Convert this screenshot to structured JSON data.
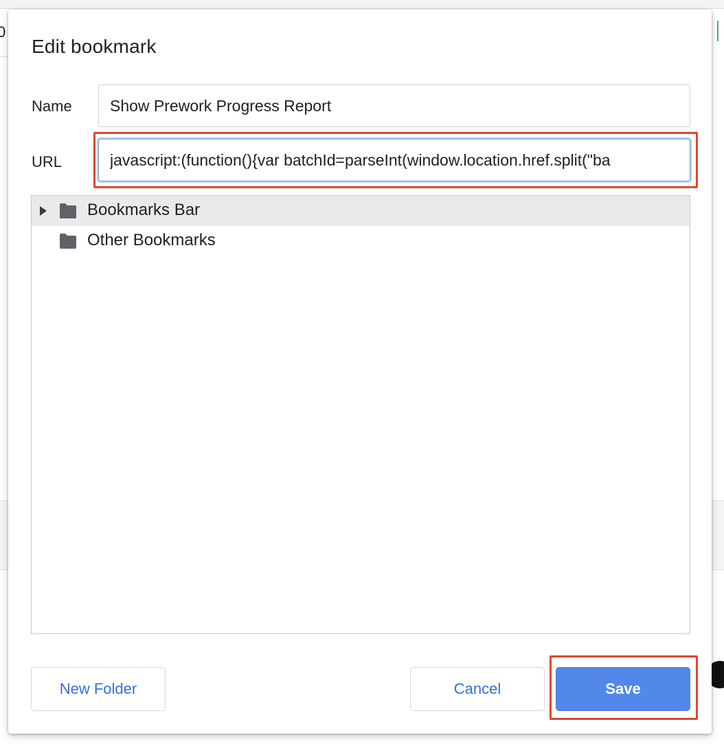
{
  "background": {
    "left_edge_text": "0"
  },
  "dialog": {
    "title": "Edit bookmark",
    "name_field": {
      "label": "Name",
      "value": "Show Prework Progress Report"
    },
    "url_field": {
      "label": "URL",
      "value": "javascript:(function(){var batchId=parseInt(window.location.href.split(\"ba"
    },
    "folder_tree": {
      "items": [
        {
          "label": "Bookmarks Bar",
          "expandable": true,
          "selected": true,
          "icon": "folder-icon"
        },
        {
          "label": "Other Bookmarks",
          "expandable": false,
          "selected": false,
          "icon": "folder-icon"
        }
      ]
    },
    "buttons": {
      "new_folder": "New Folder",
      "cancel": "Cancel",
      "save": "Save"
    }
  },
  "annotations": {
    "highlight_color": "#e2462d",
    "highlighted": [
      "url-field",
      "save-button"
    ]
  },
  "colors": {
    "primary_button": "#5288ea",
    "link_text": "#3470d8",
    "focus_ring": "#b9d1f6",
    "folder_icon": "#5f6368"
  }
}
